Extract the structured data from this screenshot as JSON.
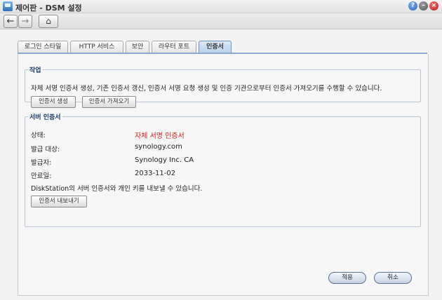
{
  "window": {
    "title": "제어판 - DSM 설정",
    "help_label": "?",
    "min_label": "–",
    "close_label": "×"
  },
  "nav": {
    "back": "←",
    "forward": "→",
    "home": "⌂"
  },
  "tabs": [
    {
      "label": "로그인 스타일",
      "active": false
    },
    {
      "label": "HTTP 서비스",
      "active": false
    },
    {
      "label": "보안",
      "active": false
    },
    {
      "label": "라우터 포트",
      "active": false
    },
    {
      "label": "인증서",
      "active": true
    }
  ],
  "task_section": {
    "legend": "작업",
    "description": "자체 서명 인증서 생성, 기존 인증서 갱신, 인증서 서명 요청 생성 및 인증 기관으로부터 인증서 가져오기를 수행할 수 있습니다.",
    "create_button": "인증서 생성",
    "import_button": "인증서 가져오기"
  },
  "cert_section": {
    "legend": "서버 인증서",
    "rows": [
      {
        "label": "상태:",
        "value": "자체 서명 인증서",
        "highlight": true
      },
      {
        "label": "발급 대상:",
        "value": "synology.com",
        "highlight": false
      },
      {
        "label": "발급자:",
        "value": "Synology Inc. CA",
        "highlight": false
      },
      {
        "label": "만료일:",
        "value": "2033-11-02",
        "highlight": false
      }
    ],
    "export_note": "DiskStation의 서버 인증서와 개인 키를 내보낼 수 있습니다.",
    "export_button": "인증서 내보내기"
  },
  "footer": {
    "apply": "적용",
    "cancel": "취소"
  }
}
